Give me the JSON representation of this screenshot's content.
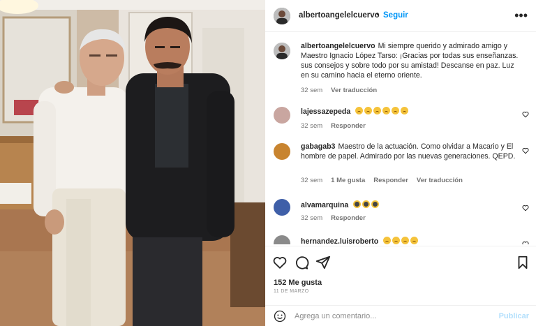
{
  "post": {
    "username": "albertoangelelcuervo",
    "separator": "•",
    "follow_label": "Seguir",
    "more_icon": "more-horizontal-icon",
    "more_glyph": "•••"
  },
  "caption": {
    "username": "albertoangelelcuervo",
    "text": "Mi siempre querido y admirado amigo y Maestro Ignacio López Tarso: ¡Gracias por todas sus enseñanzas. sus consejos y sobre todo por su amistad! Descanse en paz. Luz en su camino hacia el eterno oriente.",
    "time": "32 sem",
    "translate_label": "Ver traducción"
  },
  "comments": [
    {
      "username": "lajessazepeda",
      "emoji_count": 6,
      "emoji": "crying-face-icon",
      "time": "32 sem",
      "reply_label": "Responder",
      "avatar_color": "#c9a6a0"
    },
    {
      "username": "gabagab3",
      "text": "Maestro de la actuación. Como olvidar a Macario y El hombre de papel. Admirado por las nuevas generaciones. QEPD.",
      "time": "32 sem",
      "likes": "1 Me gusta",
      "reply_label": "Responder",
      "translate_label": "Ver traducción",
      "avatar_color": "#c8842f"
    },
    {
      "username": "alvamarquina",
      "emoji_count": 3,
      "emoji": "hands-over-mouth-icon",
      "time": "32 sem",
      "reply_label": "Responder",
      "avatar_color": "#3f5fa8"
    },
    {
      "username": "hernandez.luisroberto",
      "emoji_count": 4,
      "emoji": "crying-face-icon",
      "avatar_color": "#8a8a8a"
    }
  ],
  "actions": {
    "like_icon": "heart-icon",
    "comment_icon": "comment-icon",
    "share_icon": "send-icon",
    "save_icon": "bookmark-icon",
    "likes_text": "152 Me gusta",
    "date": "11 DE MARZO"
  },
  "add_comment": {
    "placeholder": "Agrega un comentario...",
    "publish_label": "Publicar",
    "emoji_icon": "smiley-icon"
  },
  "colors": {
    "accent": "#0095f6",
    "publish_disabled": "#b2dffc",
    "meta": "#737373"
  }
}
